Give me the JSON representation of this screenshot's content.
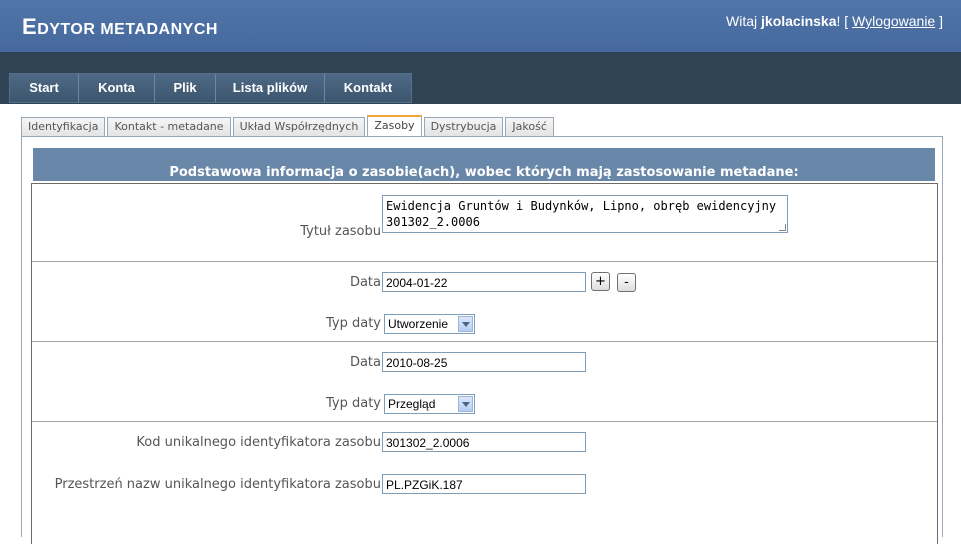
{
  "app": {
    "title_first": "E",
    "title_rest": "DYTOR METADANYCH"
  },
  "user": {
    "greeting": "Witaj ",
    "username": "jkolacinska",
    "after_name": "! [ ",
    "logout": "Wylogowanie",
    "close_bracket": " ]"
  },
  "nav": [
    {
      "label": "Start"
    },
    {
      "label": "Konta"
    },
    {
      "label": "Plik"
    },
    {
      "label": "Lista plików"
    },
    {
      "label": "Kontakt"
    }
  ],
  "tabs": [
    {
      "label": "Identyfikacja"
    },
    {
      "label": "Kontakt - metadane"
    },
    {
      "label": "Układ Współrzędnych"
    },
    {
      "label": "Zasoby"
    },
    {
      "label": "Dystrybucja"
    },
    {
      "label": "Jakość"
    }
  ],
  "active_tab": "Zasoby",
  "section": {
    "title": "Podstawowa informacja o zasobie(ach), wobec których mają zastosowanie metadane:"
  },
  "form": {
    "resource_title": {
      "label": "Tytuł zasobu",
      "value": "Ewidencja Gruntów i Budynków, Lipno, obręb ewidencyjny 301302_2.0006"
    },
    "dates": [
      {
        "date_label": "Data",
        "date_value": "2004-01-22",
        "type_label": "Typ daty",
        "type_value": "Utworzenie",
        "add_label": "+",
        "remove_label": "-"
      },
      {
        "date_label": "Data",
        "date_value": "2010-08-25",
        "type_label": "Typ daty",
        "type_value": "Przegląd"
      }
    ],
    "identifier_code": {
      "label": "Kod unikalnego identyfikatora zasobu",
      "value": "301302_2.0006"
    },
    "identifier_namespace": {
      "label": "Przestrzeń nazw unikalnego identyfikatora zasobu",
      "value": "PL.PZGiK.187"
    }
  },
  "colors": {
    "header": "#4b6ea2",
    "nav_band": "#2f4355",
    "section_header": "#6987a8",
    "active_tab_accent": "#f0a53a"
  }
}
